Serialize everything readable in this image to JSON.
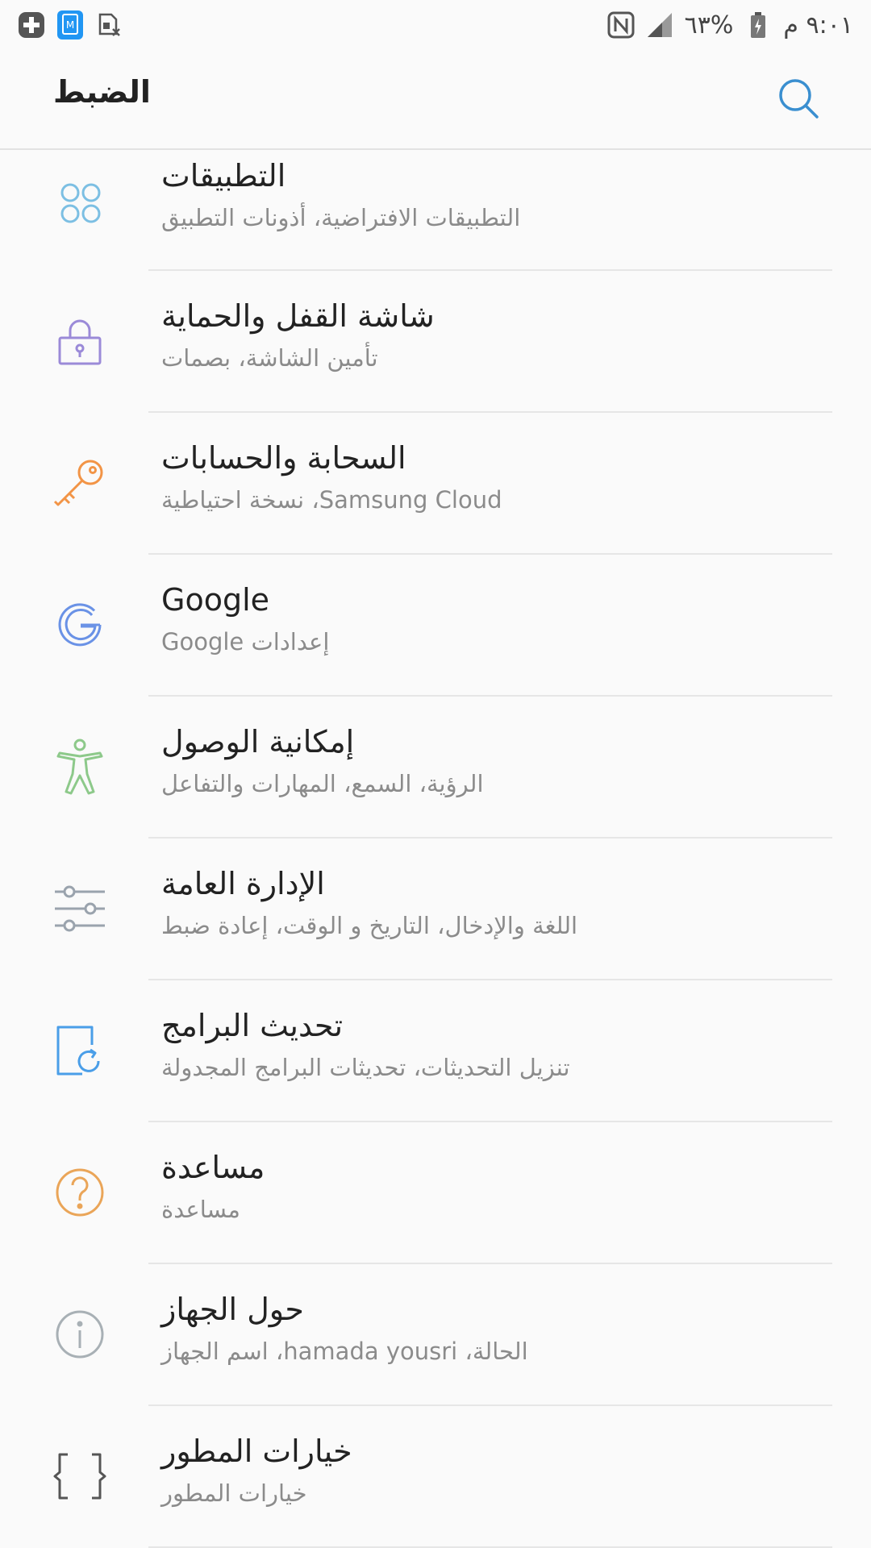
{
  "status_bar": {
    "time": "٩:٠١ م",
    "battery": "٦٣%",
    "left_icons": [
      "plus-circle-icon",
      "phone-m-icon",
      "sim-off-icon"
    ],
    "right_icons": [
      "nfc-icon",
      "signal-icon",
      "battery-charging-icon"
    ]
  },
  "header": {
    "title": "الضبط",
    "search_icon": "search-icon"
  },
  "colors": {
    "accent": "#3a8fd0",
    "apps": "#7cbfe3",
    "lock": "#9b8ad8",
    "key": "#f29446",
    "google": "#6a92e6",
    "accessibility": "#8dc98a",
    "general": "#9aa3ad",
    "update": "#4a9ee8",
    "help": "#eaa558",
    "about": "#a8b0b5",
    "developer": "#555555"
  },
  "settings": {
    "items": [
      {
        "title": "التطبيقات",
        "subtitle": "التطبيقات الافتراضية، أذونات التطبيق",
        "icon": "apps-grid-icon"
      },
      {
        "title": "شاشة القفل والحماية",
        "subtitle": "تأمين الشاشة، بصمات",
        "icon": "lock-icon"
      },
      {
        "title": "السحابة والحسابات",
        "subtitle": "Samsung Cloud، نسخة احتياطية",
        "icon": "key-icon"
      },
      {
        "title": "Google",
        "subtitle": "إعدادات Google",
        "icon": "google-icon"
      },
      {
        "title": "إمكانية الوصول",
        "subtitle": "الرؤية، السمع، المهارات والتفاعل",
        "icon": "accessibility-icon"
      },
      {
        "title": "الإدارة العامة",
        "subtitle": "اللغة والإدخال، التاريخ و الوقت، إعادة ضبط",
        "icon": "sliders-icon"
      },
      {
        "title": "تحديث البرامج",
        "subtitle": "تنزيل التحديثات، تحديثات البرامج المجدولة",
        "icon": "update-icon"
      },
      {
        "title": "مساعدة",
        "subtitle": "مساعدة",
        "icon": "help-icon"
      },
      {
        "title": "حول الجهاز",
        "subtitle": "الحالة، hamada yousri، اسم الجهاز",
        "icon": "info-icon"
      },
      {
        "title": "خيارات المطور",
        "subtitle": "خيارات المطور",
        "icon": "braces-icon"
      }
    ]
  }
}
